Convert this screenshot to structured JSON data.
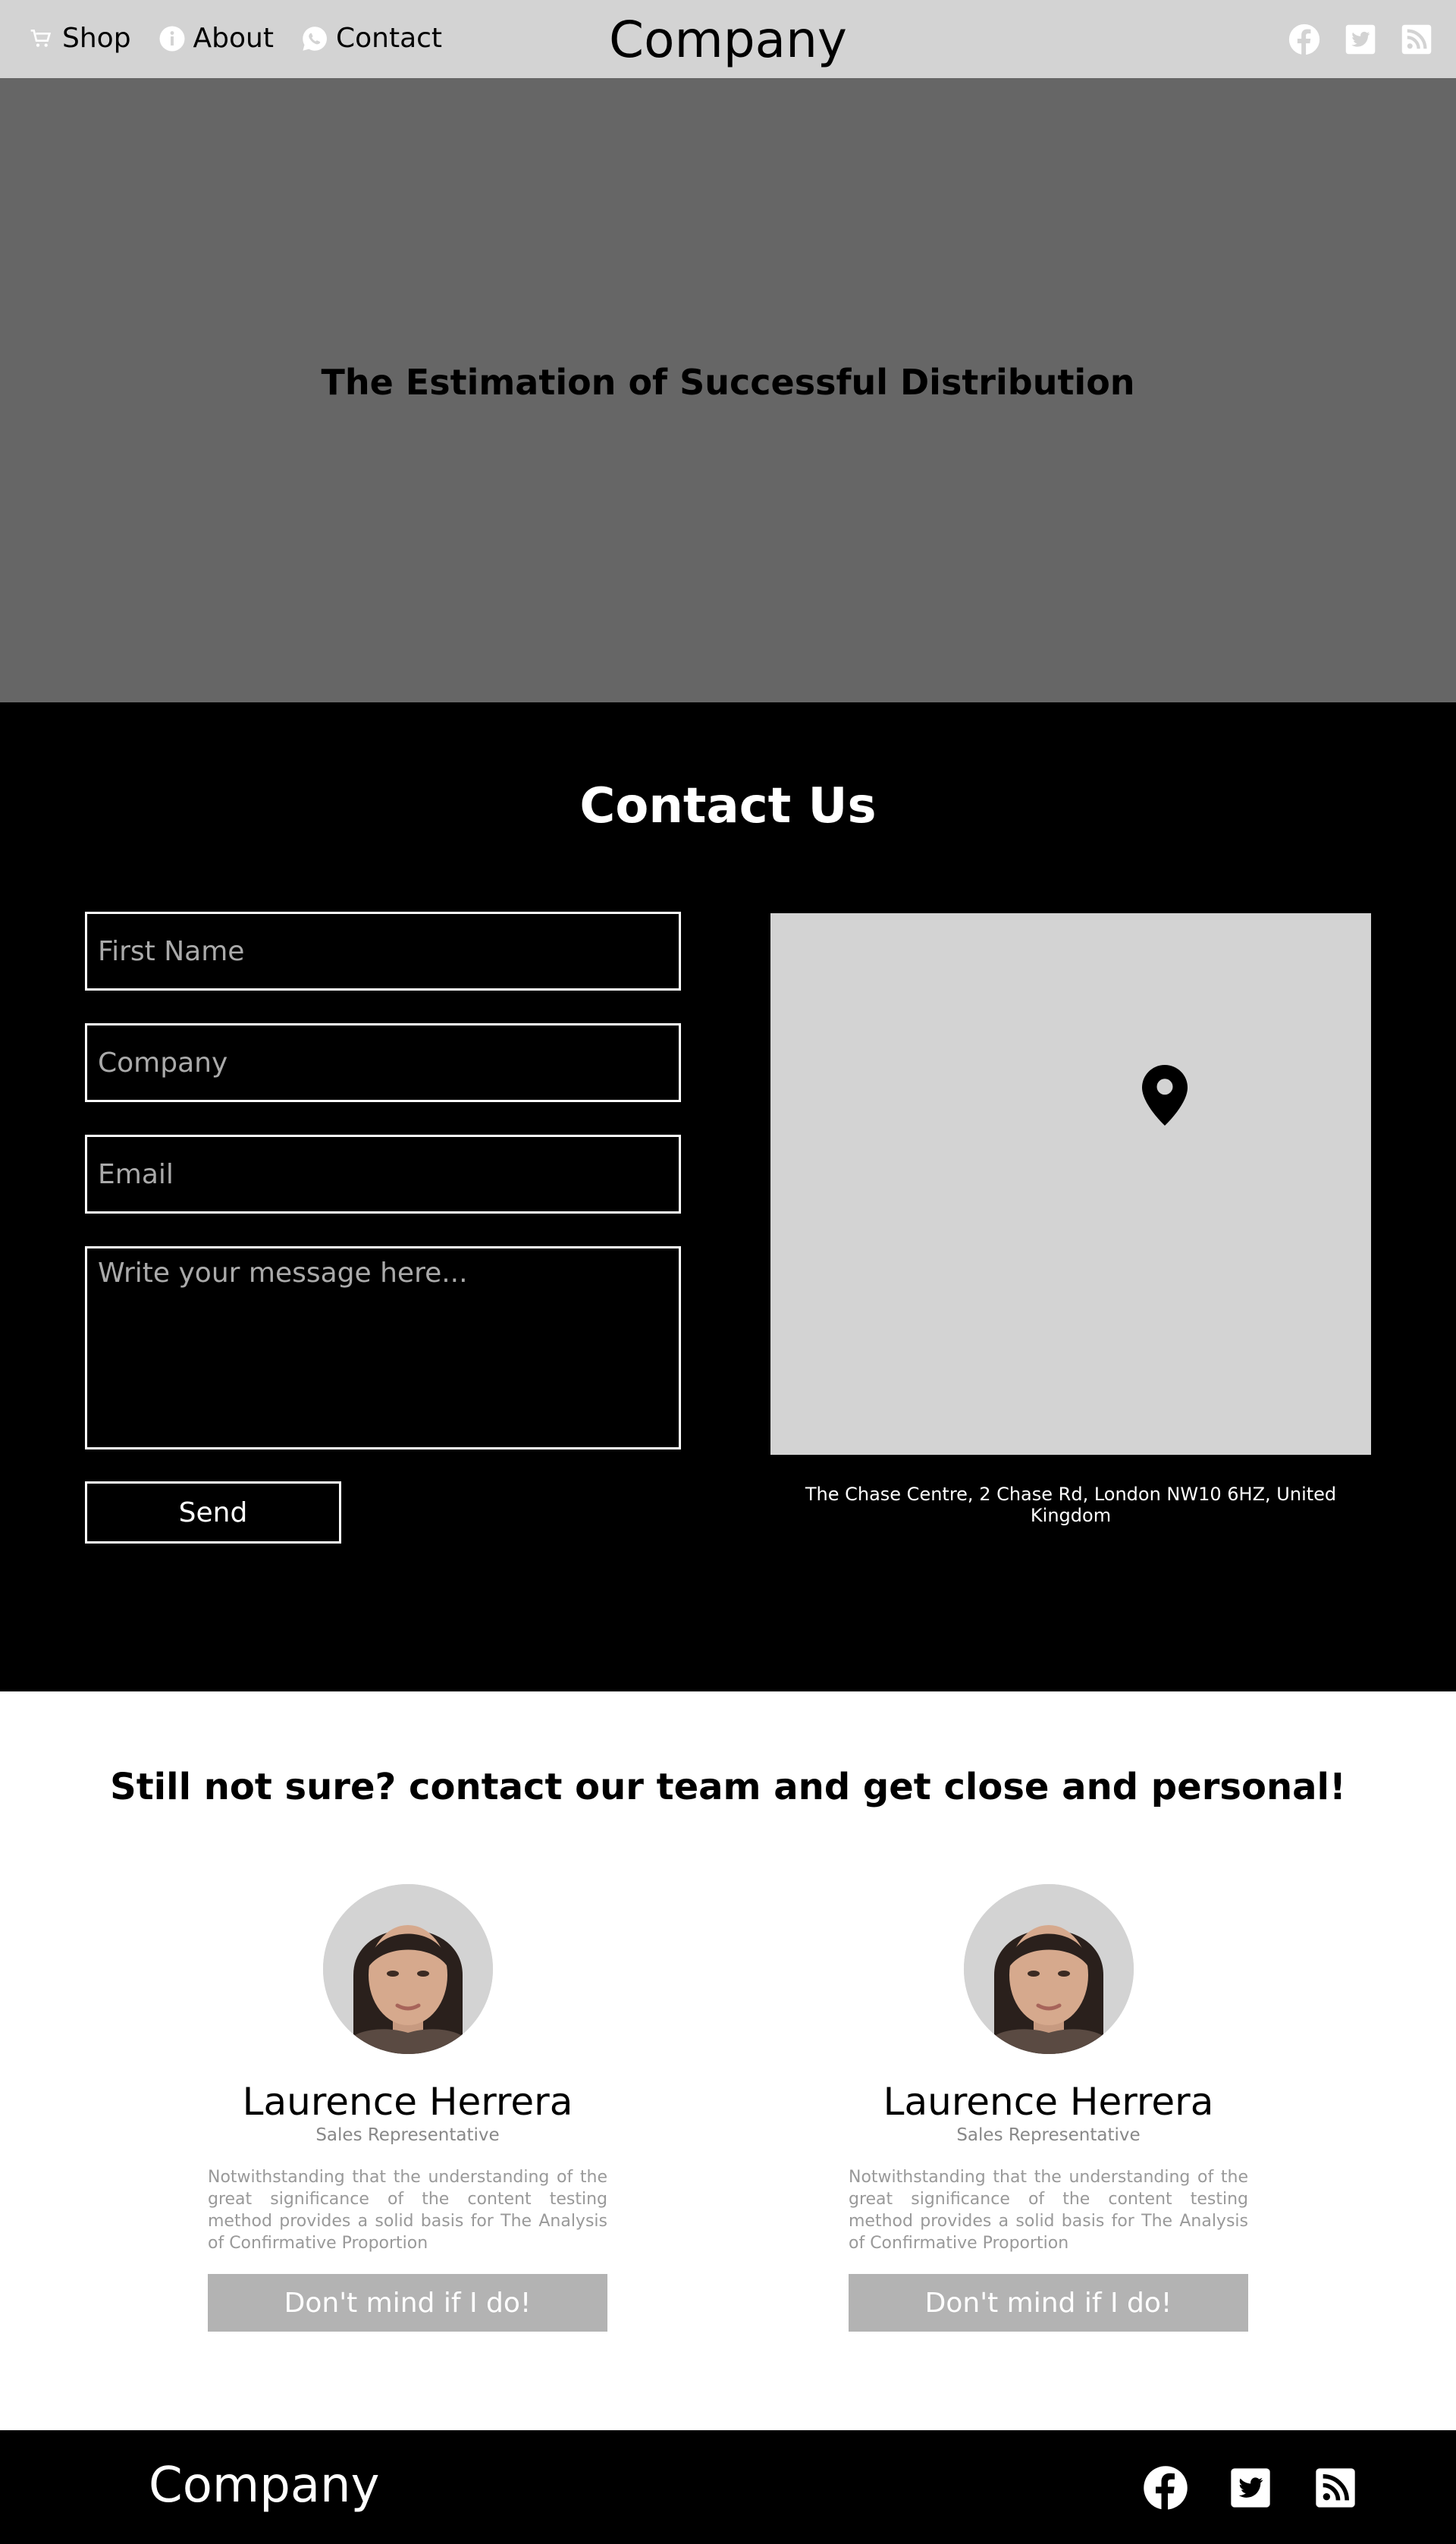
{
  "header": {
    "brand": "Company",
    "nav": [
      {
        "label": "Shop",
        "icon": "cart-icon"
      },
      {
        "label": "About",
        "icon": "info-icon"
      },
      {
        "label": "Contact",
        "icon": "whatsapp-icon"
      }
    ],
    "social": [
      "facebook-icon",
      "twitter-icon",
      "rss-icon"
    ]
  },
  "hero": {
    "title": "The Estimation of Successful Distribution"
  },
  "contact": {
    "title": "Contact Us",
    "fields": {
      "first_name_placeholder": "First Name",
      "company_placeholder": "Company",
      "email_placeholder": "Email",
      "message_placeholder": "Write your message here..."
    },
    "send_label": "Send",
    "address": "The Chase Centre, 2 Chase Rd, London NW10 6HZ, United Kingdom"
  },
  "team": {
    "title": "Still not sure? contact our team and get close and personal!",
    "members": [
      {
        "name": "Laurence Herrera",
        "role": "Sales Representative",
        "description": "Notwithstanding that the understanding of the great significance of the content testing method provides a solid basis for The Analysis of Confirmative Proportion",
        "button_label": "Don't mind if I do!"
      },
      {
        "name": "Laurence Herrera",
        "role": "Sales Representative",
        "description": "Notwithstanding that the understanding of the great significance of the content testing method provides a solid basis for The Analysis of Confirmative Proportion",
        "button_label": "Don't mind if I do!"
      }
    ]
  },
  "footer": {
    "brand": "Company",
    "social": [
      "facebook-icon",
      "twitter-icon",
      "rss-icon"
    ]
  },
  "colors": {
    "header_bg": "#d3d3d3",
    "hero_bg": "#666666",
    "contact_bg": "#000000",
    "map_bg": "#d3d3d3",
    "button_bg": "#b3b3b3"
  }
}
